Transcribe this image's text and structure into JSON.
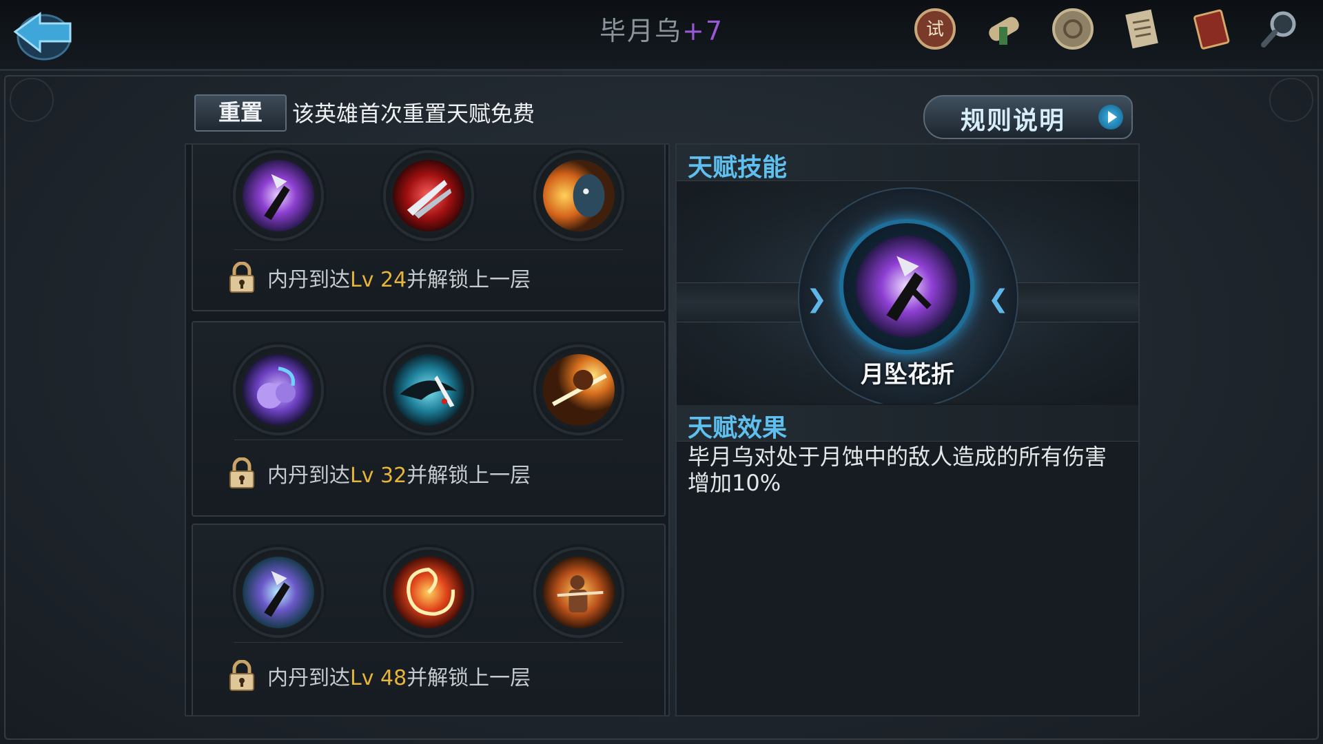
{
  "header": {
    "back_icon": "back-arrow-icon",
    "hero_name": "毕月乌",
    "hero_plus": "+7",
    "icons": [
      "trial-seal-icon",
      "scroll-icon",
      "coin-icon",
      "document-icon",
      "book-icon",
      "magnifier-icon"
    ]
  },
  "reset": {
    "button_label": "重置",
    "hint": "该英雄首次重置天赋免费"
  },
  "rules_button": {
    "label": "规则说明",
    "icon": "play-arrow-icon"
  },
  "talent_tree": {
    "tiers": [
      {
        "lock_prefix": "内丹到达",
        "level": "Lv 24",
        "lock_suffix": "并解锁上一层",
        "skills": [
          "moon-blade-purple",
          "blood-claw-red",
          "demon-fire-orange"
        ]
      },
      {
        "lock_prefix": "内丹到达",
        "level": "Lv 32",
        "lock_suffix": "并解锁上一层",
        "skills": [
          "purple-cloud-swirl",
          "teal-bird-strike",
          "orange-slash"
        ]
      },
      {
        "lock_prefix": "内丹到达",
        "level": "Lv 48",
        "lock_suffix": "并解锁上一层",
        "skills": [
          "moon-blade-teal",
          "fire-vortex-orange",
          "warrior-flame"
        ]
      }
    ]
  },
  "detail": {
    "skill_header": "天赋技能",
    "skill_name": "月坠花折",
    "effect_header": "天赋效果",
    "effect_text": "毕月乌对处于月蚀中的敌人造成的所有伤害增加10%"
  },
  "colors": {
    "accent_blue": "#5fc0ef",
    "level_gold": "#e6b53a",
    "plus_purple": "#9a58d6"
  }
}
